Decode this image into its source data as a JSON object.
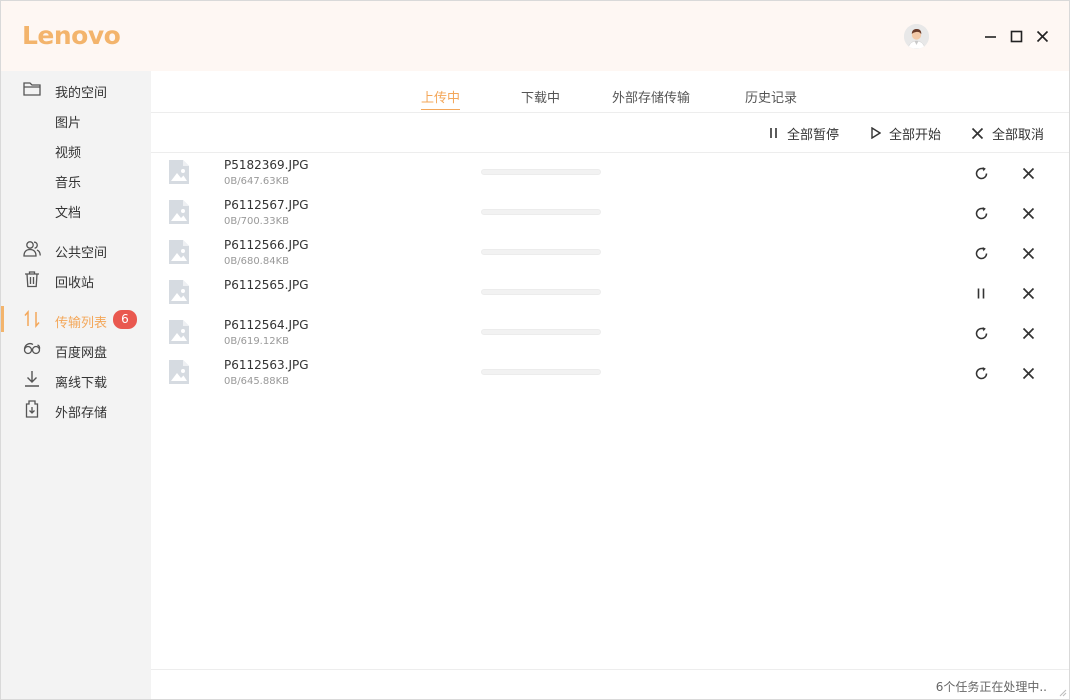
{
  "app": {
    "logo": "Lenovo"
  },
  "window_controls": {
    "minimize": "minimize-icon",
    "maximize": "maximize-icon",
    "close": "close-icon"
  },
  "sidebar": {
    "items": [
      {
        "label": "我的空间",
        "icon": "folder-icon"
      },
      {
        "label": "图片"
      },
      {
        "label": "视频"
      },
      {
        "label": "音乐"
      },
      {
        "label": "文档"
      },
      {
        "label": "公共空间",
        "icon": "users-icon"
      },
      {
        "label": "回收站",
        "icon": "trash-icon"
      },
      {
        "label": "传输列表",
        "icon": "transfer-icon",
        "badge": "6",
        "active": true
      },
      {
        "label": "百度网盘",
        "icon": "baidu-cloud-icon"
      },
      {
        "label": "离线下载",
        "icon": "download-icon"
      },
      {
        "label": "外部存储",
        "icon": "external-storage-icon"
      }
    ]
  },
  "tabs": [
    {
      "label": "上传中",
      "active": true
    },
    {
      "label": "下载中"
    },
    {
      "label": "外部存储传输"
    },
    {
      "label": "历史记录"
    }
  ],
  "toolbar": {
    "pause_all": "全部暂停",
    "start_all": "全部开始",
    "cancel_all": "全部取消"
  },
  "transfers": [
    {
      "name": "P5182369.JPG",
      "size": "0B/647.63KB",
      "progress": 0,
      "action": "retry-icon"
    },
    {
      "name": "P6112567.JPG",
      "size": "0B/700.33KB",
      "progress": 0,
      "action": "retry-icon"
    },
    {
      "name": "P6112566.JPG",
      "size": "0B/680.84KB",
      "progress": 0,
      "action": "retry-icon"
    },
    {
      "name": "P6112565.JPG",
      "size": "",
      "progress": 0,
      "action": "pause-icon"
    },
    {
      "name": "P6112564.JPG",
      "size": "0B/619.12KB",
      "progress": 0,
      "action": "retry-icon"
    },
    {
      "name": "P6112563.JPG",
      "size": "0B/645.88KB",
      "progress": 0,
      "action": "retry-icon"
    }
  ],
  "status": {
    "text": "6个任务正在处理中.."
  },
  "colors": {
    "accent": "#f3b46c",
    "badge": "#e9584f",
    "sidebar_bg": "#f3f3f3",
    "titlebar_bg": "#fef7f3"
  }
}
